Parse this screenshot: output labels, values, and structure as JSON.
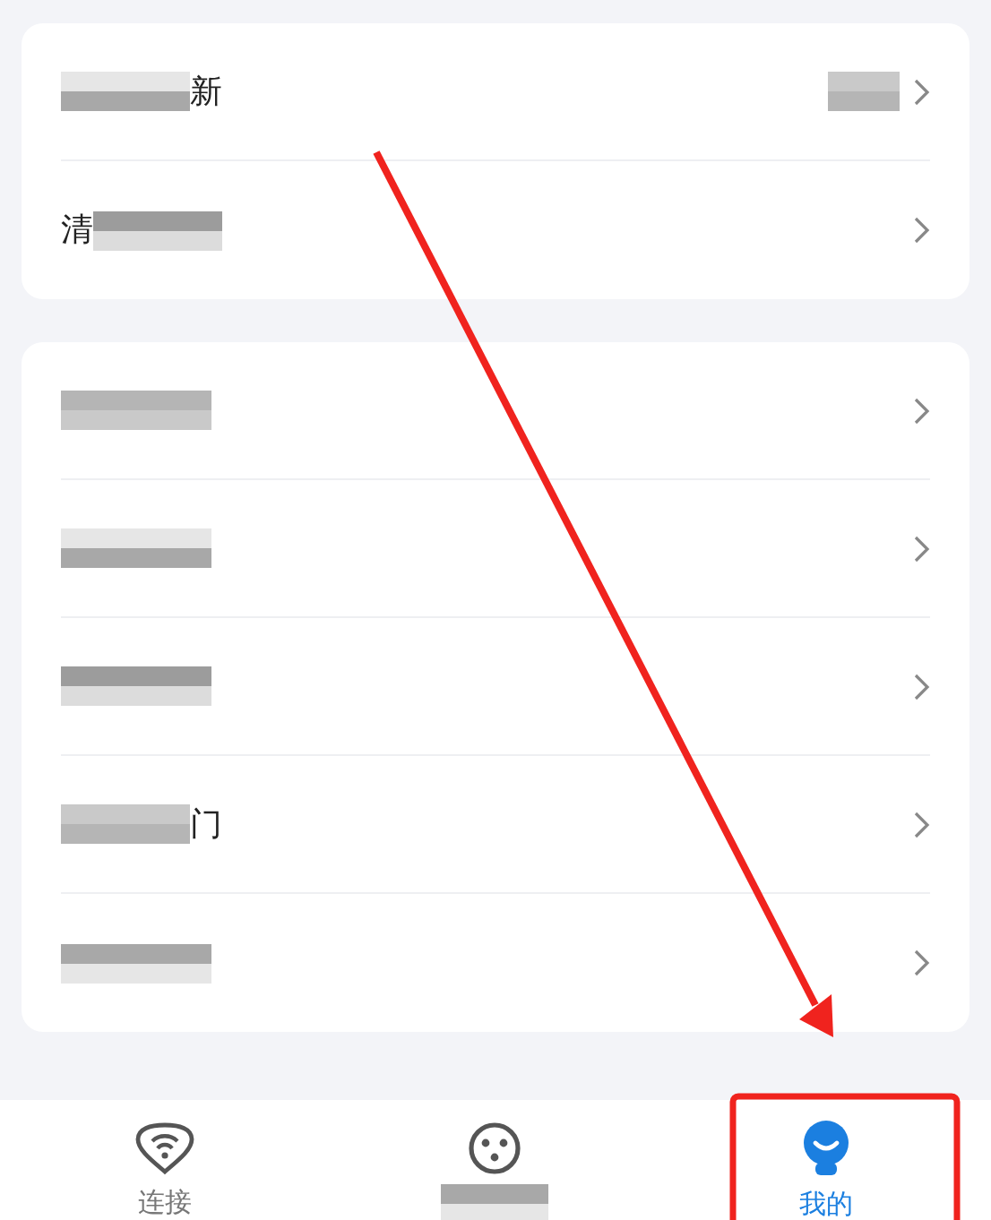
{
  "groups": [
    {
      "items": [
        {
          "kind": "blur_first",
          "visible_text": "新",
          "value": {
            "kind": "blurred"
          }
        },
        {
          "kind": "blur_last",
          "visible_text": "清"
        }
      ]
    },
    {
      "items": [
        {
          "kind": "blurred"
        },
        {
          "kind": "blurred"
        },
        {
          "kind": "blurred"
        },
        {
          "kind": "blur_first",
          "visible_text": "门"
        },
        {
          "kind": "blurred"
        }
      ]
    }
  ],
  "tabs": [
    {
      "kind": "wifi",
      "label": "连接",
      "selected": false
    },
    {
      "kind": "reel",
      "selected": false
    },
    {
      "kind": "person",
      "label": "我的",
      "selected": true
    }
  ],
  "annotations": {
    "arrow": true,
    "frame": true
  }
}
